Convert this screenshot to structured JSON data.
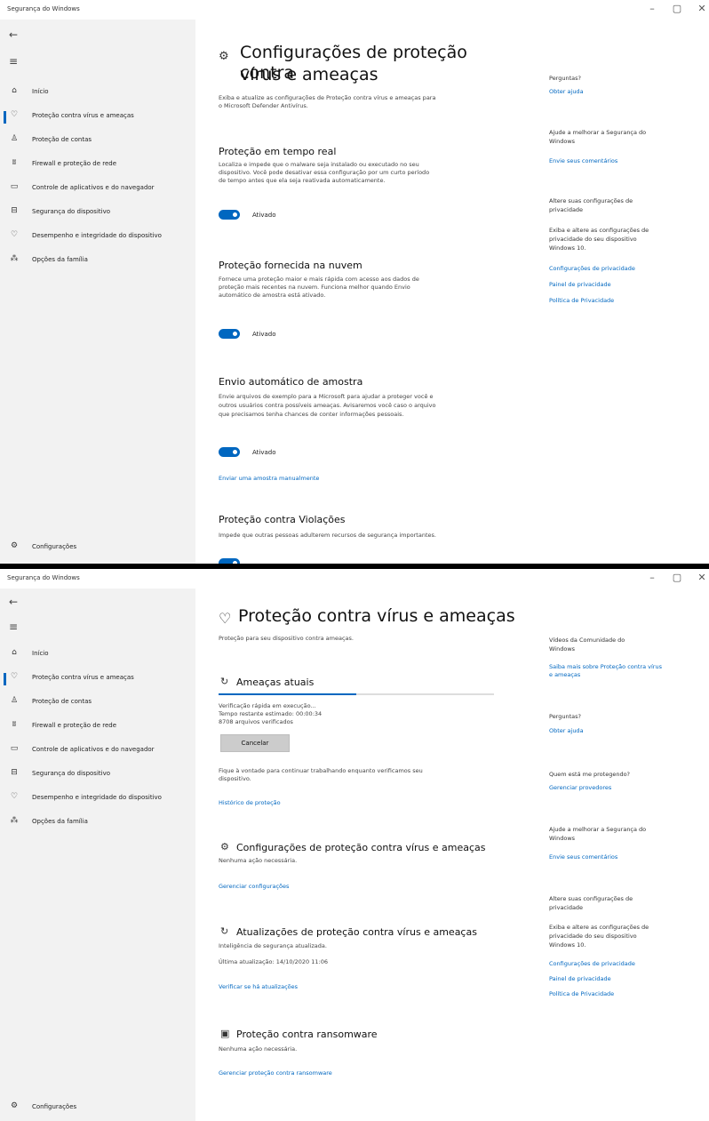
{
  "app_title": "Segurança do Windows",
  "window_controls": {
    "minimize": "–",
    "maximize": "▢",
    "close": "✕"
  },
  "icons": {
    "back": "←",
    "menu": "≡",
    "settings": "⚙"
  },
  "nav": {
    "items": [
      {
        "icon": "⌂",
        "label": "Início"
      },
      {
        "icon": "♡",
        "label": "Proteção contra vírus e ameaças"
      },
      {
        "icon": "♙",
        "label": "Proteção de contas"
      },
      {
        "icon": "ʬ",
        "label": "Firewall e proteção de rede"
      },
      {
        "icon": "▭",
        "label": "Controle de aplicativos e do navegador"
      },
      {
        "icon": "⊟",
        "label": "Segurança do dispositivo"
      },
      {
        "icon": "♡",
        "label": "Desempenho e integridade do dispositivo"
      },
      {
        "icon": "⁂",
        "label": "Opções da família"
      }
    ],
    "settings_label": "Configurações"
  },
  "screen1": {
    "title_line1": "Configurações de proteção contra",
    "title_line2": "vírus e ameaças",
    "subtitle_line1": "Exiba e atualize as configurações de Proteção contra vírus e ameaças para",
    "subtitle_line2": "o Microsoft Defender Antivírus.",
    "realtime": {
      "heading": "Proteção em tempo real",
      "desc_line1": "Localiza e impede que o malware seja instalado ou executado no seu",
      "desc_line2": "dispositivo. Você pode desativar essa configuração por um curto período",
      "desc_line3": "de tempo antes que ela seja reativada automaticamente.",
      "toggle_label": "Ativado"
    },
    "cloud": {
      "heading": "Proteção fornecida na nuvem",
      "desc_line1": "Fornece uma proteção maior e mais rápida com acesso aos dados de",
      "desc_line2": "proteção mais recentes na nuvem. Funciona melhor quando Envio",
      "desc_line3": "automático de amostra está ativado.",
      "toggle_label": "Ativado"
    },
    "sample": {
      "heading": "Envio automático de amostra",
      "desc_line1": "Envie arquivos de exemplo para a Microsoft para ajudar a proteger você e",
      "desc_line2": "outros usuários contra possíveis ameaças. Avisaremos você caso o arquivo",
      "desc_line3": "que precisamos tenha chances de conter informações pessoais.",
      "toggle_label": "Ativado",
      "manual_link": "Enviar uma amostra manualmente"
    },
    "tamper": {
      "heading": "Proteção contra Violações",
      "desc_line1": "Impede que outras pessoas adulterem recursos de segurança importantes."
    },
    "right": {
      "questions": "Perguntas?",
      "get_help": "Obter ajuda",
      "improve_line1": "Ajude a melhorar a Segurança do",
      "improve_line2": "Windows",
      "feedback": "Envie seus comentários",
      "privacy_title_line1": "Altere suas configurações de",
      "privacy_title_line2": "privacidade",
      "privacy_desc_line1": "Exiba e altere as configurações de",
      "privacy_desc_line2": "privacidade do seu dispositivo",
      "privacy_desc_line3": "Windows 10.",
      "privacy_settings": "Configurações de privacidade",
      "privacy_dashboard": "Painel de privacidade",
      "privacy_statement": "Política de Privacidade"
    }
  },
  "screen2": {
    "title": "Proteção contra vírus e ameaças",
    "subtitle": "Proteção para seu dispositivo contra ameaças.",
    "threats": {
      "heading": "Ameaças atuais",
      "progress": 0.5,
      "status_line1": "Verificação rápida em execução...",
      "status_line2": "Tempo restante estimado: 00:00:34",
      "status_line3": "8708 arquivos verificados",
      "cancel_button": "Cancelar",
      "note_line1": "Fique à vontade para continuar trabalhando enquanto verificamos seu",
      "note_line2": "dispositivo.",
      "history_link": "Histórico de proteção"
    },
    "settings_section": {
      "heading": "Configurações de proteção contra vírus e ameaças",
      "status": "Nenhuma ação necessária.",
      "link": "Gerenciar configurações"
    },
    "updates_section": {
      "heading": "Atualizações de proteção contra vírus e ameaças",
      "status_line1": "Inteligência de segurança atualizada.",
      "status_line2": "Última atualização: 14/10/2020 11:06",
      "link": "Verificar se há atualizações"
    },
    "ransomware_section": {
      "heading": "Proteção contra ransomware",
      "status": "Nenhuma ação necessária.",
      "link": "Gerenciar proteção contra ransomware"
    },
    "right": {
      "community_line1": "Vídeos da Comunidade do",
      "community_line2": "Windows",
      "community_link_line1": "Saiba mais sobre Proteção contra vírus",
      "community_link_line2": "e ameaças",
      "questions": "Perguntas?",
      "get_help": "Obter ajuda",
      "who_protects": "Quem está me protegendo?",
      "manage_providers": "Gerenciar provedores",
      "improve_line1": "Ajude a melhorar a Segurança do",
      "improve_line2": "Windows",
      "feedback": "Envie seus comentários",
      "privacy_title_line1": "Altere suas configurações de",
      "privacy_title_line2": "privacidade",
      "privacy_desc_line1": "Exiba e altere as configurações de",
      "privacy_desc_line2": "privacidade do seu dispositivo",
      "privacy_desc_line3": "Windows 10.",
      "privacy_settings": "Configurações de privacidade",
      "privacy_dashboard": "Painel de privacidade",
      "privacy_statement": "Política de Privacidade"
    }
  },
  "colors": {
    "accent": "#0067c0",
    "sidebar_bg": "#f2f2f2"
  }
}
